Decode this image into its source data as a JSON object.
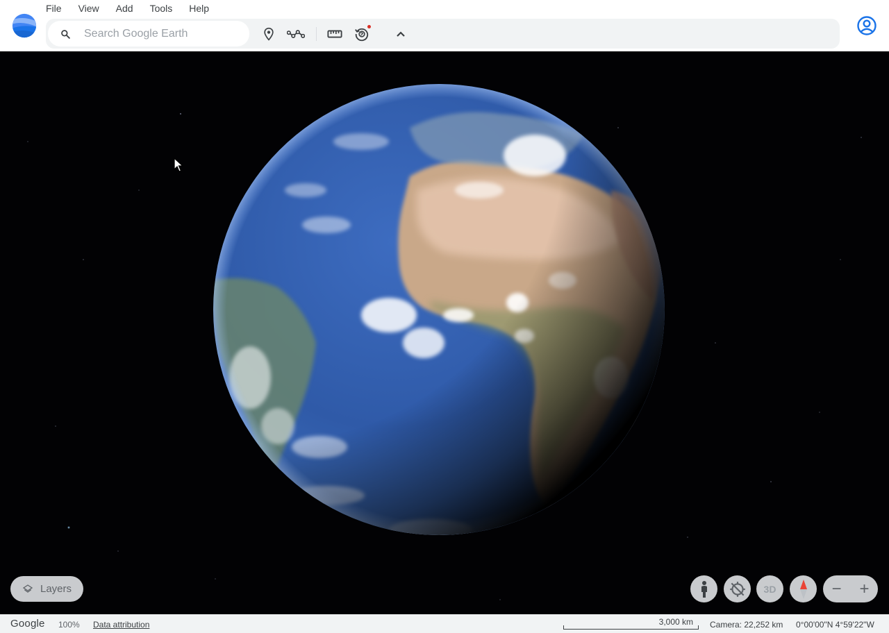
{
  "app": {
    "logo_icon": "google-earth-logo",
    "account_icon": "account-circle-icon"
  },
  "menu": [
    "File",
    "View",
    "Add",
    "Tools",
    "Help"
  ],
  "toolbar": {
    "search_placeholder": "Search Google Earth",
    "search_value": "",
    "buttons": [
      {
        "icon": "placemark-icon"
      },
      {
        "icon": "path-icon"
      },
      {
        "icon": "ruler-icon"
      },
      {
        "icon": "history-icon",
        "notification": true
      },
      {
        "icon": "chevron-up-icon"
      }
    ]
  },
  "viewer": {
    "layers_label": "Layers",
    "street_view_icon": "pegman-icon",
    "reset_view_icon": "reset-orientation-icon",
    "three_d_label": "3D",
    "compass_icon": "compass-icon",
    "zoom_out_label": "−",
    "zoom_in_label": "+"
  },
  "status": {
    "brand": "Google",
    "zoom": "100%",
    "data_attribution": "Data attribution",
    "scale_label": "3,000 km",
    "camera": "Camera: 22,252 km",
    "coordinates": "0°00'00\"N 4°59'22\"W"
  },
  "colors": {
    "toolbar_bg": "#f1f3f4",
    "accent": "#1a73e8",
    "notification": "#d93025",
    "compass_red": "#ea4335"
  }
}
